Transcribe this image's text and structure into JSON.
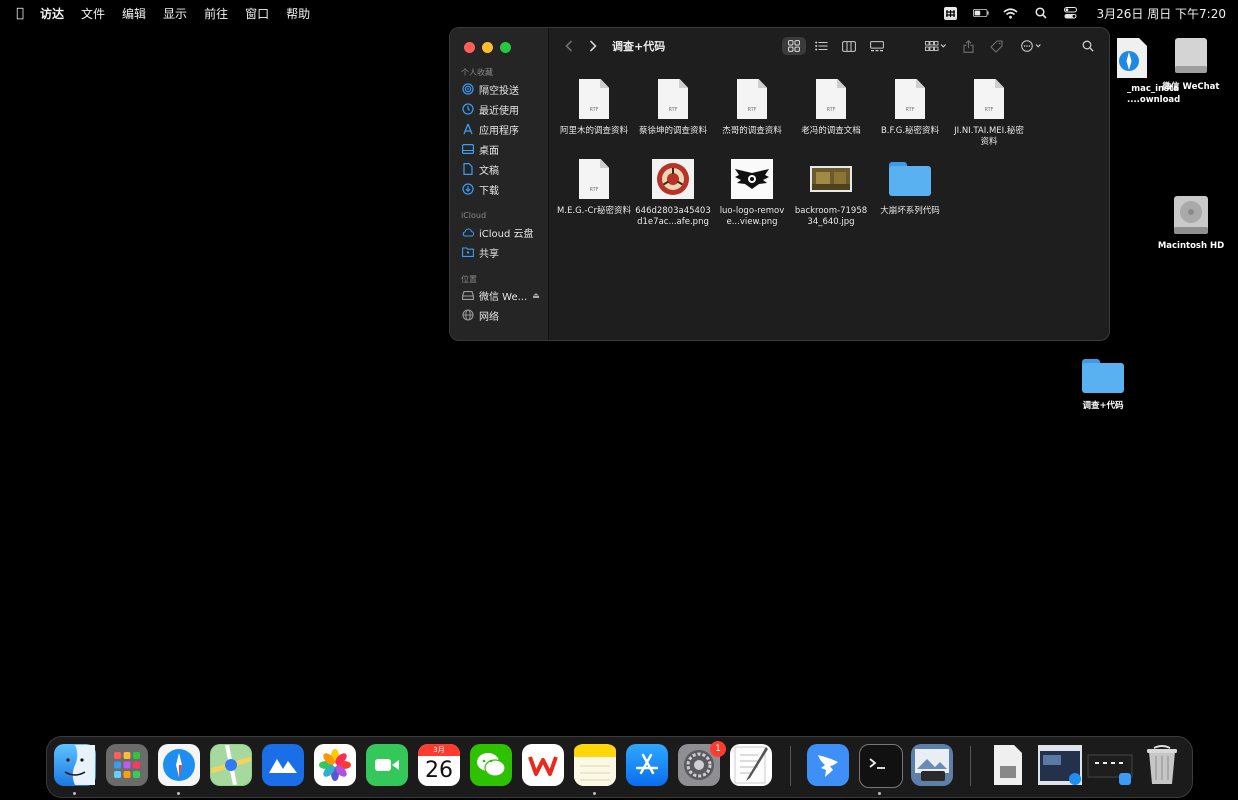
{
  "menubar": {
    "app_name": "访达",
    "items": [
      "文件",
      "编辑",
      "显示",
      "前往",
      "窗口",
      "帮助"
    ],
    "clock": "3月26日 周日 下午7:20"
  },
  "window": {
    "title": "调查+代码",
    "sidebar": {
      "sections": {
        "favorites": "个人收藏",
        "icloud": "iCloud",
        "locations": "位置"
      },
      "items": {
        "airdrop": "隔空投送",
        "recents": "最近使用",
        "applications": "应用程序",
        "desktop": "桌面",
        "documents": "文稿",
        "downloads": "下载",
        "icloud_drive": "iCloud 云盘",
        "shared": "共享",
        "wechat": "微信 We...",
        "network": "网络"
      }
    },
    "files": [
      {
        "name": "阿里木的调查资料",
        "kind": "rtf"
      },
      {
        "name": "蔡徐坤的调查资料",
        "kind": "rtf"
      },
      {
        "name": "杰哥的调查资料",
        "kind": "rtf"
      },
      {
        "name": "老冯的调查文档",
        "kind": "rtf"
      },
      {
        "name": "B.F.G.秘密资料",
        "kind": "rtf"
      },
      {
        "name": "JI.NI.TAI.MEI.秘密资料",
        "kind": "rtf"
      },
      {
        "name": "M.E.G.-Cr秘密资料",
        "kind": "rtf"
      },
      {
        "name": "646d2803a45403d1e7ac...afe.png",
        "kind": "png-scp"
      },
      {
        "name": "luo-logo-remove...view.png",
        "kind": "png-logo"
      },
      {
        "name": "backroom-7195834_640.jpg",
        "kind": "jpg"
      },
      {
        "name": "大崩坏系列代码",
        "kind": "folder"
      }
    ],
    "rtf_label": "RTF"
  },
  "desktop": {
    "installer": "_mac_insta\n....ownload",
    "wechat_drive": "微信 WeChat",
    "macintosh_hd": "Macintosh HD",
    "folder": "调查+代码"
  },
  "dock": {
    "calendar_month": "3月",
    "calendar_day": "26",
    "settings_badge": "1"
  }
}
